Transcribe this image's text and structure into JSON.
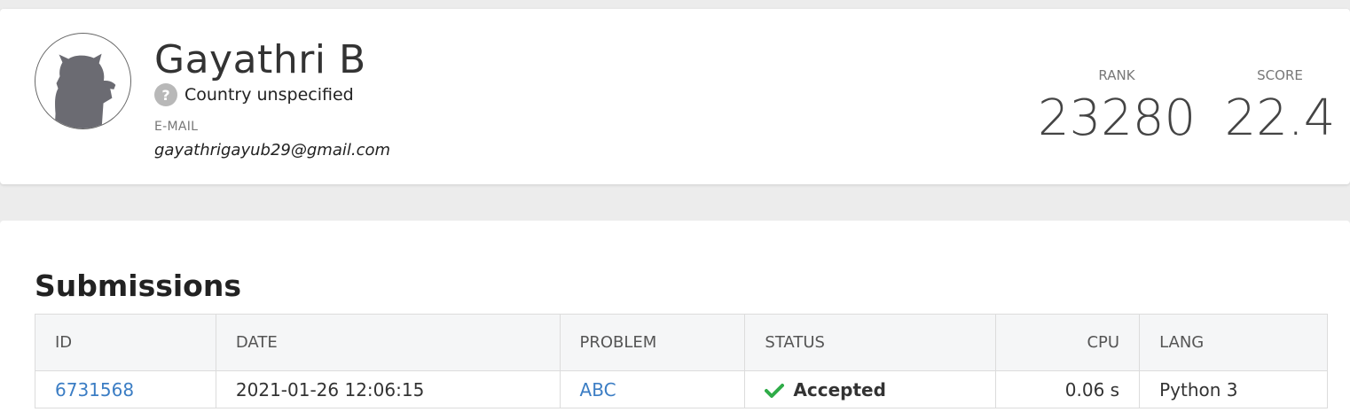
{
  "profile": {
    "name": "Gayathri B",
    "country": "Country unspecified",
    "email_label": "E-MAIL",
    "email": "gayathrigayub29@gmail.com",
    "rank_label": "RANK",
    "rank": "23280",
    "score_label": "SCORE",
    "score": "22.4"
  },
  "submissions": {
    "title": "Submissions",
    "columns": [
      "ID",
      "DATE",
      "PROBLEM",
      "STATUS",
      "CPU",
      "LANG"
    ],
    "rows": [
      {
        "id": "6731568",
        "date": "2021-01-26 12:06:15",
        "problem": "ABC",
        "status": "Accepted",
        "cpu": "0.06 s",
        "lang": "Python 3"
      }
    ]
  },
  "colors": {
    "link": "#3b7dc4",
    "accepted": "#2fac48",
    "page_background": "#ececec"
  },
  "icons": {
    "country": "question-mark-circle-icon",
    "status": "check-icon",
    "avatar": "cat-silhouette-avatar"
  }
}
